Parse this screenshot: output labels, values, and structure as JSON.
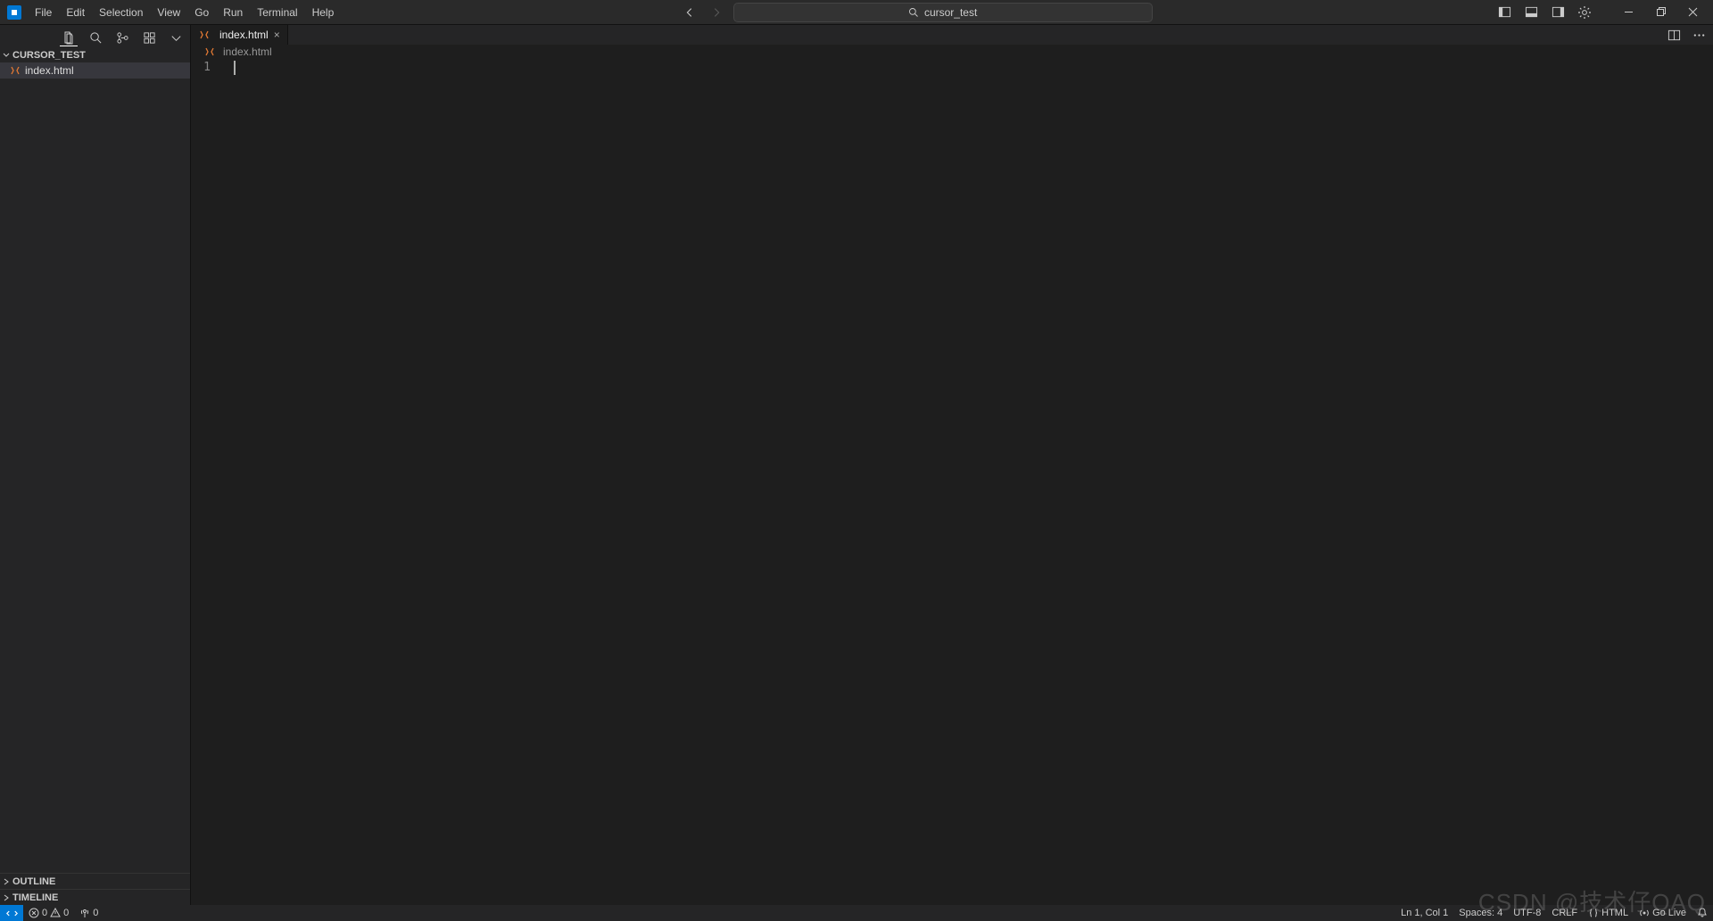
{
  "titlebar": {
    "menus": [
      "File",
      "Edit",
      "Selection",
      "View",
      "Go",
      "Run",
      "Terminal",
      "Help"
    ],
    "search_text": "cursor_test"
  },
  "sidebar": {
    "project_name": "CURSOR_TEST",
    "files": [
      {
        "name": "index.html"
      }
    ],
    "sections": {
      "outline": "OUTLINE",
      "timeline": "TIMELINE"
    }
  },
  "tabs": [
    {
      "label": "index.html"
    }
  ],
  "breadcrumb": {
    "file": "index.html"
  },
  "editor": {
    "line_number": "1"
  },
  "status": {
    "errors": "0",
    "warnings": "0",
    "ports": "0",
    "cursor_pos": "Ln 1, Col 1",
    "spaces": "Spaces: 4",
    "encoding": "UTF-8",
    "eol": "CRLF",
    "language": "HTML",
    "live": "Go Live"
  },
  "watermark": "CSDN @技术仔QAQ"
}
